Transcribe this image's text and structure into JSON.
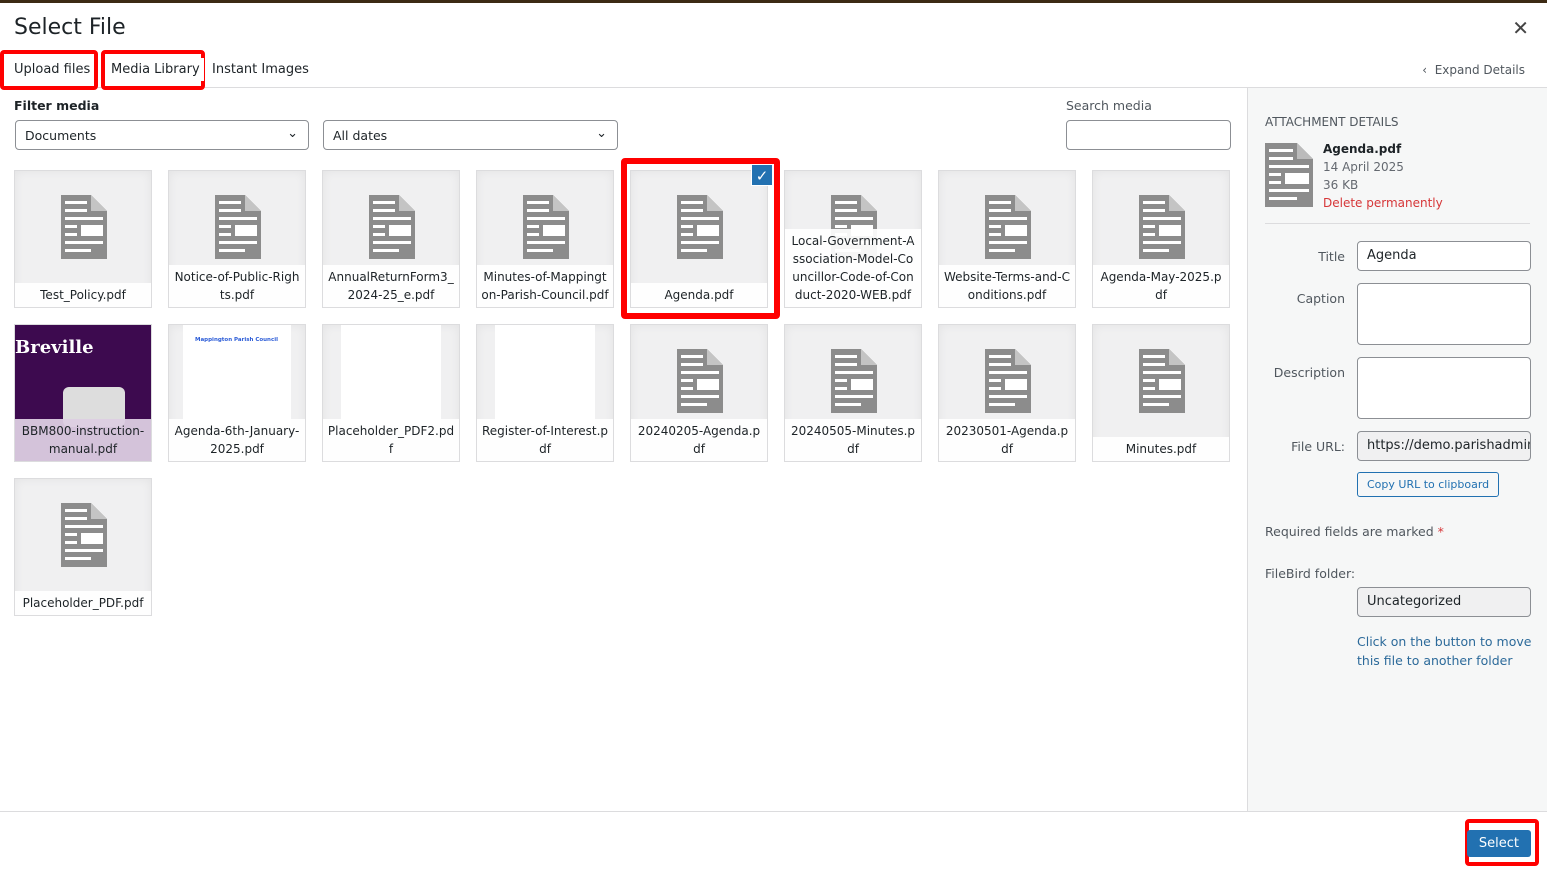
{
  "modal": {
    "title": "Select File",
    "close_icon": "close-icon"
  },
  "tabs": [
    {
      "label": "Upload files"
    },
    {
      "label": "Media Library"
    },
    {
      "label": "Instant Images"
    }
  ],
  "expand_details": "Expand Details",
  "filter": {
    "label": "Filter media",
    "type_value": "Documents",
    "date_value": "All dates"
  },
  "search": {
    "label": "Search media",
    "value": ""
  },
  "highlight_color": "#ff0000",
  "accent_color": "#2271b1",
  "media": [
    {
      "name": "Test_Policy.pdf",
      "thumb": "document-icon"
    },
    {
      "name": "Notice-of-Public-Rights.pdf",
      "thumb": "document-icon"
    },
    {
      "name": "AnnualReturnForm3_2024-25_e.pdf",
      "thumb": "document-icon"
    },
    {
      "name": "Minutes-of-Mappington-Parish-Council.pdf",
      "thumb": "document-icon"
    },
    {
      "name": "Agenda.pdf",
      "thumb": "document-icon",
      "selected": true
    },
    {
      "name": "Local-Government-Association-Model-Councillor-Code-of-Conduct-2020-WEB.pdf",
      "thumb": "document-icon"
    },
    {
      "name": "Website-Terms-and-Conditions.pdf",
      "thumb": "document-icon"
    },
    {
      "name": "Agenda-May-2025.pdf",
      "thumb": "document-icon"
    },
    {
      "name": "BBM800-instruction-manual.pdf",
      "thumb": "breville-cover",
      "thumb_text": "Breville"
    },
    {
      "name": "Agenda-6th-January-2025.pdf",
      "thumb": "agenda-page",
      "thumb_text": "Mappington Parish Council"
    },
    {
      "name": "Placeholder_PDF2.pdf",
      "thumb": "blank-page"
    },
    {
      "name": "Register-of-Interest.pdf",
      "thumb": "blank-page"
    },
    {
      "name": "20240205-Agenda.pdf",
      "thumb": "document-icon"
    },
    {
      "name": "20240505-Minutes.pdf",
      "thumb": "document-icon"
    },
    {
      "name": "20230501-Agenda.pdf",
      "thumb": "document-icon"
    },
    {
      "name": "Minutes.pdf",
      "thumb": "document-icon"
    },
    {
      "name": "Placeholder_PDF.pdf",
      "thumb": "document-icon"
    }
  ],
  "details": {
    "heading": "ATTACHMENT DETAILS",
    "filename": "Agenda.pdf",
    "date": "14 April 2025",
    "size": "36 KB",
    "delete": "Delete permanently",
    "title_label": "Title",
    "title_value": "Agenda",
    "caption_label": "Caption",
    "caption_value": "",
    "description_label": "Description",
    "description_value": "",
    "url_label": "File URL:",
    "url_value": "https://demo.parishadmin.",
    "copy_label": "Copy URL to clipboard",
    "required_note": "Required fields are marked",
    "required_star": "*",
    "folder_label": "FileBird folder:",
    "folder_value": "Uncategorized",
    "folder_hint": "Click on the button to move this file to another folder"
  },
  "footer": {
    "select_label": "Select"
  }
}
